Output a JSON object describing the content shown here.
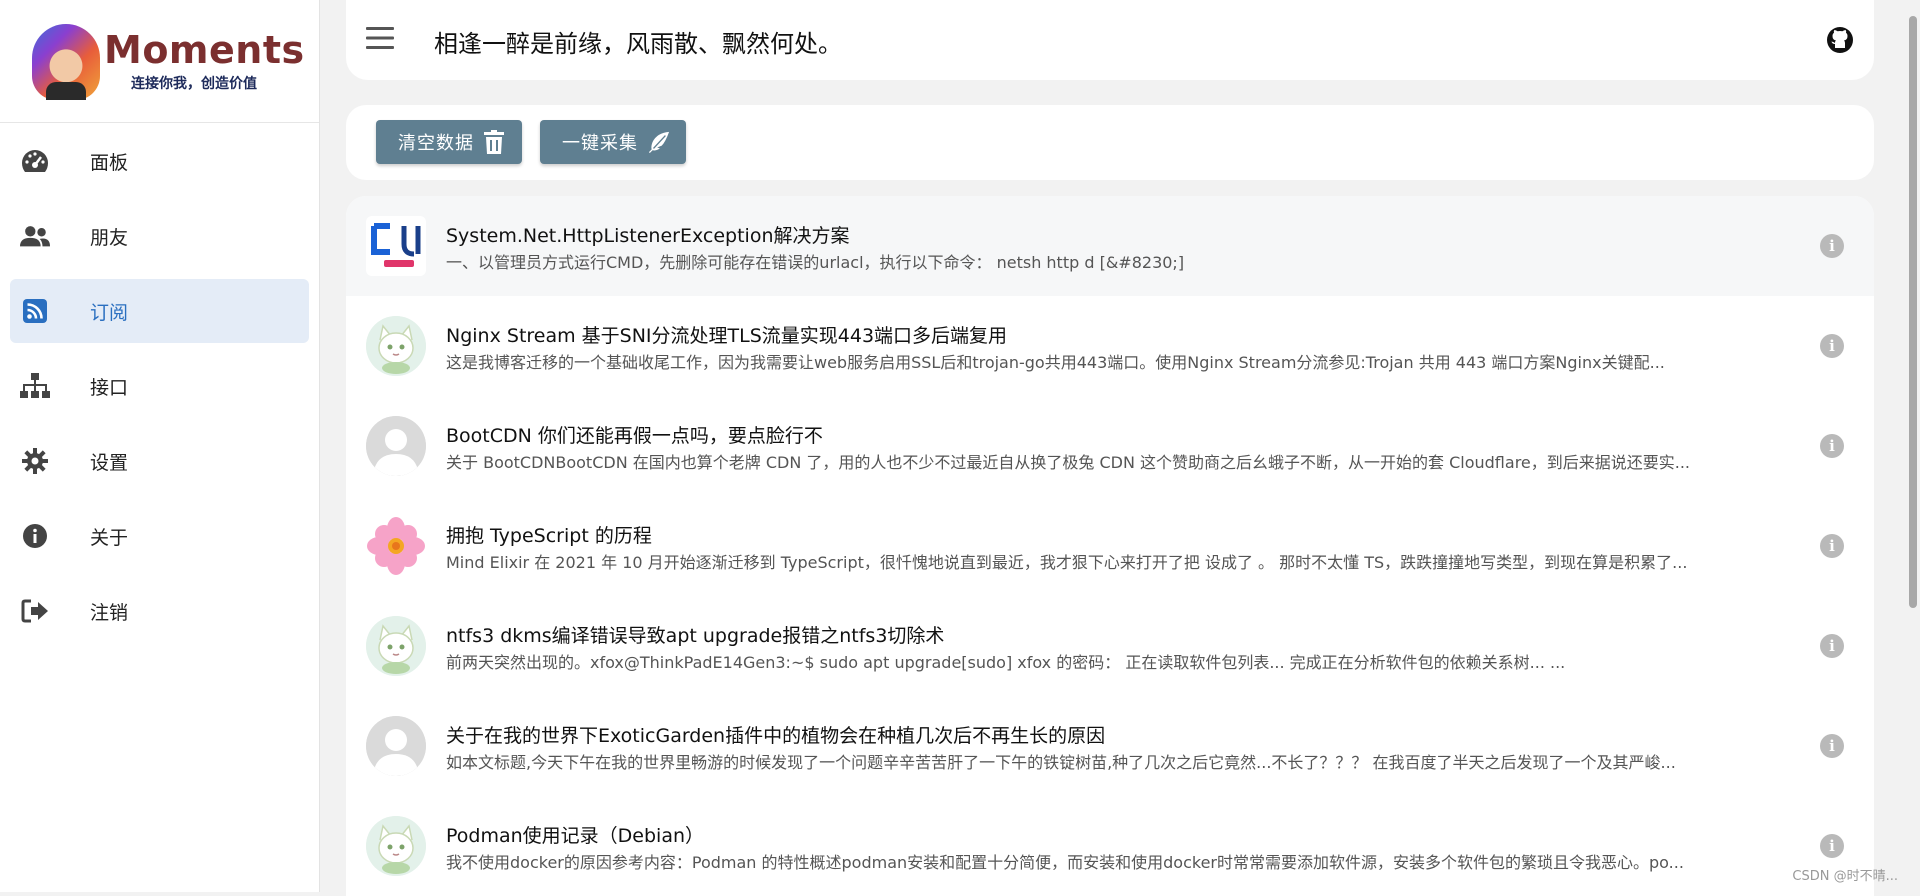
{
  "sidebar": {
    "logo_title": "Moments",
    "logo_subtitle": "连接你我，创造价值",
    "items": [
      {
        "label": "面板",
        "icon": "dashboard-icon"
      },
      {
        "label": "朋友",
        "icon": "users-icon"
      },
      {
        "label": "订阅",
        "icon": "rss-icon",
        "active": true
      },
      {
        "label": "接口",
        "icon": "sitemap-icon"
      },
      {
        "label": "设置",
        "icon": "gear-icon"
      },
      {
        "label": "关于",
        "icon": "info-icon"
      },
      {
        "label": "注销",
        "icon": "logout-icon"
      }
    ]
  },
  "header": {
    "title": "相逢一醉是前缘，风雨散、飘然何处。",
    "menu_icon": "hamburger-icon",
    "github_icon": "github-icon"
  },
  "toolbar": {
    "clear_label": "清空数据",
    "clear_icon": "trash-icon",
    "collect_label": "一键采集",
    "collect_icon": "feather-icon",
    "button_color": "#5f7f91"
  },
  "posts": [
    {
      "title": "System.Net.HttpListenerException解决方案",
      "desc": "一、以管理员方式运行CMD，先删除可能存在错误的urlacl，执行以下命令：  netsh http d [&#8230;]",
      "avatar": "brand-logo"
    },
    {
      "title": "Nginx Stream 基于SNI分流处理TLS流量实现443端口多后端复用",
      "desc": "这是我博客迁移的一个基础收尾工作，因为我需要让web服务启用SSL后和trojan-go共用443端口。使用Nginx Stream分流参见:Trojan 共用 443 端口方案Nginx关键配...",
      "avatar": "cat-avatar"
    },
    {
      "title": "BootCDN 你们还能再假一点吗，要点脸行不",
      "desc": "关于 BootCDNBootCDN 在国内也算个老牌 CDN 了，用的人也不少不过最近自从换了极兔 CDN 这个赞助商之后幺蛾子不断，从一开始的套 Cloudflare，到后来据说还要实...",
      "avatar": "default-avatar"
    },
    {
      "title": "拥抱 TypeScript 的历程",
      "desc": "Mind Elixir 在 2021 年 10 月开始逐渐迁移到 TypeScript，很忏愧地说直到最近，我才狠下心来打开了把 设成了 。 那时不太懂 TS，跌跌撞撞地写类型，到现在算是积累了...",
      "avatar": "flower-avatar"
    },
    {
      "title": "ntfs3 dkms编译错误导致apt upgrade报错之ntfs3切除术",
      "desc": "前两天突然出现的。xfox@ThinkPadE14Gen3:~$ sudo apt upgrade[sudo] xfox 的密码：  正在读取软件包列表... 完成正在分析软件包的依赖关系树... ...",
      "avatar": "cat-avatar"
    },
    {
      "title": "关于在我的世界下ExoticGarden插件中的植物会在种植几次后不再生长的原因",
      "desc": "如本文标题,今天下午在我的世界里畅游的时候发现了一个问题辛辛苦苦肝了一下午的铁锭树苗,种了几次之后它竟然...不长了？？？ 在我百度了半天之后发现了一个及其严峻...",
      "avatar": "default-avatar"
    },
    {
      "title": "Podman使用记录（Debian）",
      "desc": "我不使用docker的原因参考内容：Podman 的特性概述podman安装和配置十分简便，而安装和使用docker时常常需要添加软件源，安装多个软件包的繁琐且令我恶心。po...",
      "avatar": "cat-avatar"
    }
  ],
  "watermark": "CSDN @时不晴..."
}
